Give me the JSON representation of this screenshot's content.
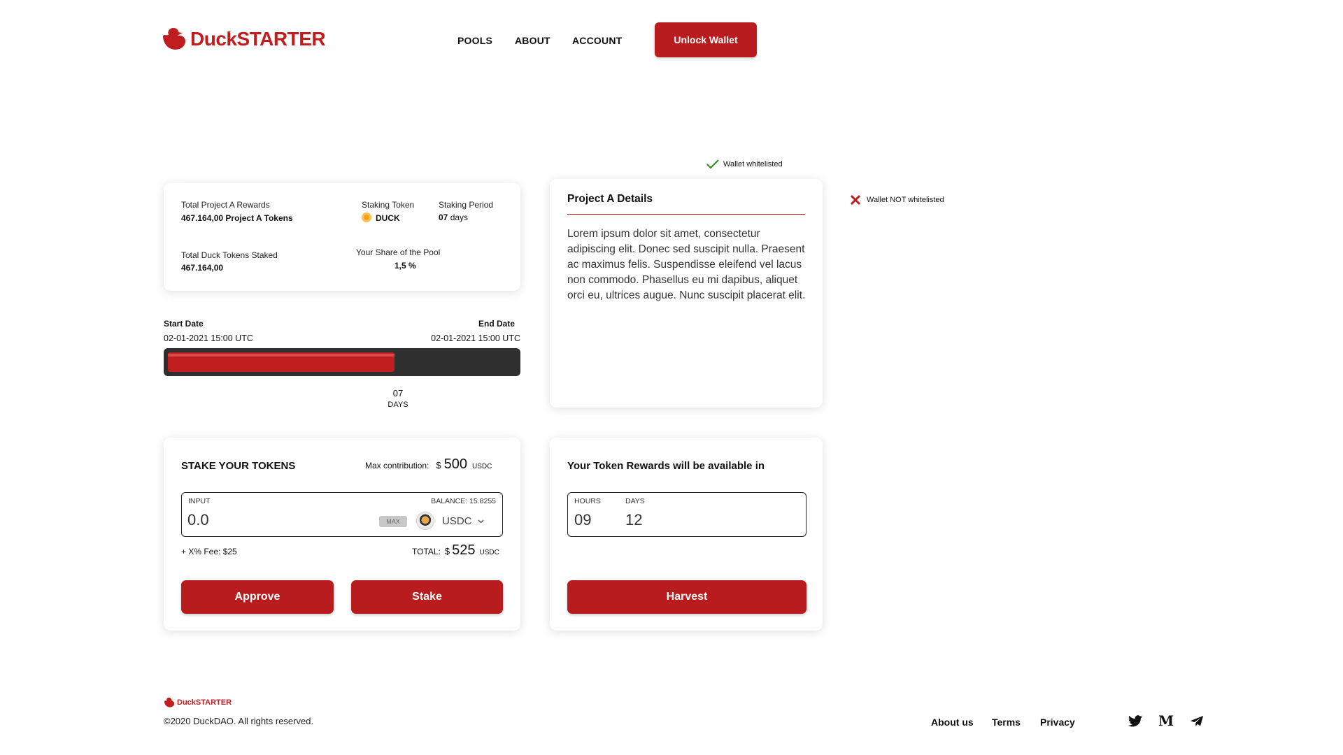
{
  "header": {
    "logo_prefix": "Duck",
    "logo_suffix": "STARTER",
    "nav": [
      "POOLS",
      "ABOUT",
      "ACCOUNT"
    ],
    "unlock_label": "Unlock Wallet"
  },
  "whitelist": {
    "ok_label": "Wallet whitelisted",
    "not_label": "Wallet NOT whitelisted"
  },
  "pool_info": {
    "total_rewards_label": "Total Project A Rewards",
    "total_rewards_value": "467.164,00 Project A Tokens",
    "staking_token_label": "Staking Token",
    "staking_token_value": "DUCK",
    "staking_period_label": "Staking Period",
    "staking_period_value": "07",
    "staking_period_unit": "days",
    "total_staked_label": "Total Duck Tokens Staked",
    "total_staked_value": "467.164,00",
    "share_label": "Your Share of the Pool",
    "share_value": "1,5 %"
  },
  "timeline": {
    "start_label": "Start Date",
    "start_value": "02-01-2021 15:00 UTC",
    "end_label": "End Date",
    "end_value": "02-01-2021 15:00 UTC",
    "progress": 0.65,
    "countdown_value": "07",
    "countdown_unit": "DAYS"
  },
  "details": {
    "title": "Project A Details",
    "body": "Lorem ipsum dolor sit amet, consectetur adipiscing elit. Donec sed suscipit nulla. Praesent ac maximus felis. Suspendisse eleifend vel lacus non commodo. Phasellus eu mi dapibus, aliquet orci eu, ultrices augue. Nunc suscipit placerat elit."
  },
  "stake": {
    "title": "STAKE YOUR TOKENS",
    "max_label": "Max contribution:",
    "max_currency": "$",
    "max_value": "500",
    "max_unit": "USDC",
    "input_label": "INPUT",
    "balance_label": "BALANCE: 15.8255",
    "input_value": "0.0",
    "max_button": "MAX",
    "token": "USDC",
    "fee_text": "+ X% Fee: $25",
    "total_label": "TOTAL:",
    "total_currency": "$",
    "total_value": "525",
    "total_unit": "USDC",
    "approve_label": "Approve",
    "stake_label": "Stake"
  },
  "rewards": {
    "title": "Your Token Rewards will be available in",
    "hours_label": "HOURS",
    "days_label": "DAYS",
    "hours_value": "09",
    "days_value": "12",
    "harvest_label": "Harvest"
  },
  "footer": {
    "logo_prefix": "Duck",
    "logo_suffix": "STARTER",
    "copyright": "©2020 DuckDAO. All rights reserved.",
    "links": [
      "About us",
      "Terms",
      "Privacy"
    ],
    "social_icons": [
      "twitter-icon",
      "medium-icon",
      "telegram-icon"
    ]
  },
  "colors": {
    "brand_red": "#b81c1e",
    "progress_track": "#2f2f2f",
    "coin": "#f2a31b",
    "check_green": "#3a8a2a"
  }
}
